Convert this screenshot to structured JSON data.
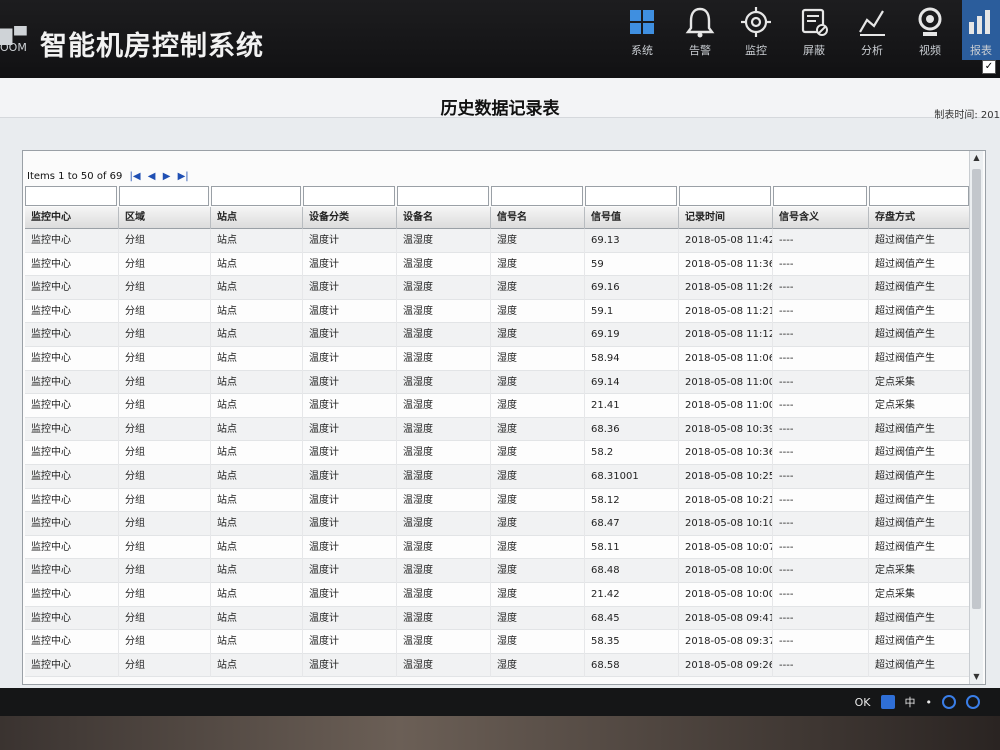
{
  "header": {
    "logo_mark": "▇▀",
    "logo_sub": "OOM",
    "app_title": "智能机房控制系统",
    "nav": [
      {
        "label": "系统",
        "icon": "grid-icon"
      },
      {
        "label": "告警",
        "icon": "bell-icon"
      },
      {
        "label": "监控",
        "icon": "target-icon"
      },
      {
        "label": "屏蔽",
        "icon": "mask-icon"
      },
      {
        "label": "分析",
        "icon": "chart-icon"
      },
      {
        "label": "视频",
        "icon": "camera-icon"
      },
      {
        "label": "报表",
        "icon": "report-icon"
      }
    ],
    "active_nav_color": "#2b5d9c"
  },
  "report": {
    "title": "历史数据记录表",
    "made_time_label": "制表时间: 201",
    "checkbox_mark": "✓"
  },
  "pager": {
    "text": "Items 1 to 50 of 69",
    "first": "|◀",
    "prev": "◀",
    "next": "▶",
    "last": "▶|"
  },
  "table": {
    "columns": [
      "监控中心",
      "区域",
      "站点",
      "设备分类",
      "设备名",
      "信号名",
      "信号值",
      "记录时间",
      "信号含义",
      "存盘方式"
    ],
    "rows": [
      [
        "监控中心",
        "分组",
        "站点",
        "温度计",
        "温湿度",
        "湿度",
        "69.13",
        "2018-05-08 11:42:",
        "----",
        "超过阀值产生"
      ],
      [
        "监控中心",
        "分组",
        "站点",
        "温度计",
        "温湿度",
        "湿度",
        "59",
        "2018-05-08 11:36:",
        "----",
        "超过阀值产生"
      ],
      [
        "监控中心",
        "分组",
        "站点",
        "温度计",
        "温湿度",
        "湿度",
        "69.16",
        "2018-05-08 11:26:",
        "----",
        "超过阀值产生"
      ],
      [
        "监控中心",
        "分组",
        "站点",
        "温度计",
        "温湿度",
        "湿度",
        "59.1",
        "2018-05-08 11:21:",
        "----",
        "超过阀值产生"
      ],
      [
        "监控中心",
        "分组",
        "站点",
        "温度计",
        "温湿度",
        "湿度",
        "69.19",
        "2018-05-08 11:12:",
        "----",
        "超过阀值产生"
      ],
      [
        "监控中心",
        "分组",
        "站点",
        "温度计",
        "温湿度",
        "湿度",
        "58.94",
        "2018-05-08 11:06:",
        "----",
        "超过阀值产生"
      ],
      [
        "监控中心",
        "分组",
        "站点",
        "温度计",
        "温湿度",
        "湿度",
        "69.14",
        "2018-05-08 11:00:",
        "----",
        "定点采集"
      ],
      [
        "监控中心",
        "分组",
        "站点",
        "温度计",
        "温湿度",
        "湿度",
        "21.41",
        "2018-05-08 11:00:",
        "----",
        "定点采集"
      ],
      [
        "监控中心",
        "分组",
        "站点",
        "温度计",
        "温湿度",
        "湿度",
        "68.36",
        "2018-05-08 10:39:",
        "----",
        "超过阀值产生"
      ],
      [
        "监控中心",
        "分组",
        "站点",
        "温度计",
        "温湿度",
        "湿度",
        "58.2",
        "2018-05-08 10:36:",
        "----",
        "超过阀值产生"
      ],
      [
        "监控中心",
        "分组",
        "站点",
        "温度计",
        "温湿度",
        "湿度",
        "68.31001",
        "2018-05-08 10:25:",
        "----",
        "超过阀值产生"
      ],
      [
        "监控中心",
        "分组",
        "站点",
        "温度计",
        "温湿度",
        "湿度",
        "58.12",
        "2018-05-08 10:21:",
        "----",
        "超过阀值产生"
      ],
      [
        "监控中心",
        "分组",
        "站点",
        "温度计",
        "温湿度",
        "湿度",
        "68.47",
        "2018-05-08 10:10:",
        "----",
        "超过阀值产生"
      ],
      [
        "监控中心",
        "分组",
        "站点",
        "温度计",
        "温湿度",
        "湿度",
        "58.11",
        "2018-05-08 10:07:",
        "----",
        "超过阀值产生"
      ],
      [
        "监控中心",
        "分组",
        "站点",
        "温度计",
        "温湿度",
        "湿度",
        "68.48",
        "2018-05-08 10:00:",
        "----",
        "定点采集"
      ],
      [
        "监控中心",
        "分组",
        "站点",
        "温度计",
        "温湿度",
        "湿度",
        "21.42",
        "2018-05-08 10:00:",
        "----",
        "定点采集"
      ],
      [
        "监控中心",
        "分组",
        "站点",
        "温度计",
        "温湿度",
        "湿度",
        "68.45",
        "2018-05-08 09:41:",
        "----",
        "超过阀值产生"
      ],
      [
        "监控中心",
        "分组",
        "站点",
        "温度计",
        "温湿度",
        "湿度",
        "58.35",
        "2018-05-08 09:37:",
        "----",
        "超过阀值产生"
      ],
      [
        "监控中心",
        "分组",
        "站点",
        "温度计",
        "温湿度",
        "湿度",
        "68.58",
        "2018-05-08 09:26:",
        "----",
        "超过阀值产生"
      ]
    ]
  },
  "scrollbar": {
    "up": "▲",
    "down": "▼"
  },
  "taskbar": {
    "tray_text_1": "OK",
    "tray_text_2": "中",
    "tray_text_3": "•",
    "tray_icons": [
      "search-icon",
      "help-icon",
      "clock-icon"
    ]
  }
}
